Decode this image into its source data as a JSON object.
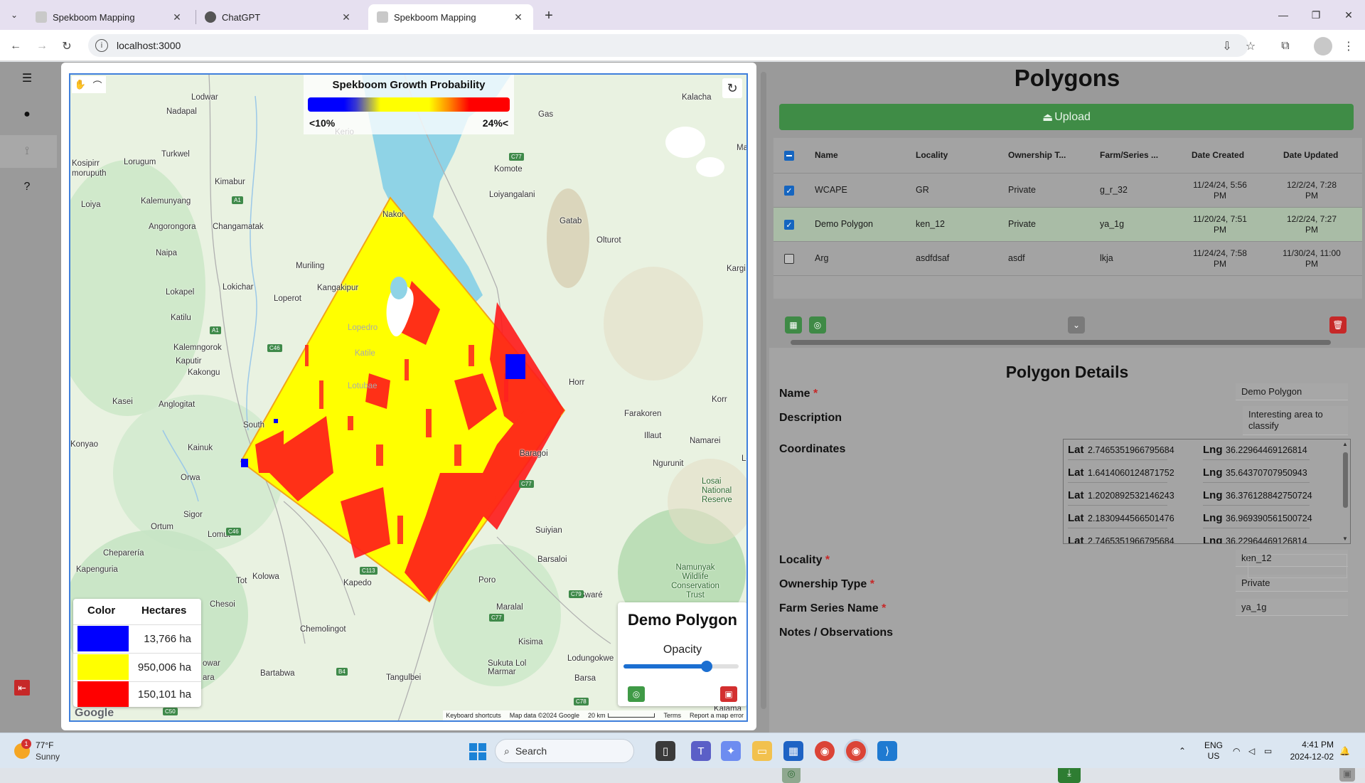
{
  "browser": {
    "tabs": [
      {
        "title": "Spekboom Mapping",
        "active": false
      },
      {
        "title": "ChatGPT",
        "active": false
      },
      {
        "title": "Spekboom Mapping",
        "active": true
      }
    ],
    "url": "localhost:3000"
  },
  "map": {
    "legend": {
      "title": "Spekboom Growth Probability",
      "low_label": "<10%",
      "high_label": "24%<"
    },
    "hectares_table": {
      "headers": [
        "Color",
        "Hectares"
      ],
      "rows": [
        {
          "color": "#0000ff",
          "hectares": "13,766 ha"
        },
        {
          "color": "#ffff00",
          "hectares": "950,006 ha"
        },
        {
          "color": "#ff0000",
          "hectares": "150,101 ha"
        }
      ]
    },
    "polygon_card": {
      "name": "Demo Polygon",
      "opacity_label": "Opacity",
      "opacity_value": 0.72
    },
    "google_logo": "Google",
    "footer": {
      "shortcuts": "Keyboard shortcuts",
      "data": "Map data ©2024 Google",
      "scale": "20 km",
      "terms": "Terms",
      "report": "Report a map error"
    },
    "places": [
      "Lodwar",
      "Nadapal",
      "Kosipirr",
      "moruputh",
      "Lorugum",
      "Turkwel",
      "Kimabur",
      "Loiya",
      "Kalemunyang",
      "Angorongora",
      "Changamatak",
      "Naipa",
      "Muriling",
      "Kangakipur",
      "Lokapel",
      "Lokichar",
      "Loperot",
      "Katilu",
      "Kalemngorok",
      "Kaputir",
      "Kakongu",
      "Kasei",
      "Anglogitat",
      "South",
      "Konyao",
      "Kainuk",
      "Orwa",
      "Sigor",
      "Ortum",
      "Lomut",
      "Cheparería",
      "Kapenguria",
      "Chesoi",
      "Tot",
      "Kolowa",
      "Kapedo",
      "Chemolingot",
      "Bartabwa",
      "Tangulbei",
      "Sukuta Lol Marmar",
      "Kisima",
      "Lodungokwe",
      "Barsa",
      "Maralal",
      "Poro",
      "Swaré",
      "Barsaloi",
      "Suiyian",
      "Baragoi",
      "Ngurunit",
      "Illaut",
      "Namarei",
      "Farakoren",
      "Korr",
      "Horr",
      "Kargi",
      "Olturot",
      "Gatab",
      "Loiyangalani",
      "Komote",
      "Kalacha",
      "Gas",
      "Ma",
      "Nakor",
      "Kerio",
      "Lopedro",
      "Katile",
      "Lotubae",
      "owar",
      "ara",
      "Namunyak Wildlife Conservation Trust",
      "Losai National Reserve",
      "Le",
      "Kalama"
    ],
    "roads": [
      "C77",
      "A1",
      "A1",
      "C46",
      "C46",
      "C77",
      "C113",
      "C79",
      "C77",
      "B4",
      "C78",
      "C50"
    ]
  },
  "polygons": {
    "title": "Polygons",
    "upload_label": "Upload",
    "columns": [
      "Name",
      "Locality",
      "Ownership T...",
      "Farm/Series ...",
      "Date Created",
      "Date Updated"
    ],
    "rows": [
      {
        "checked": true,
        "selected": false,
        "name": "WCAPE",
        "locality": "GR",
        "ownership": "Private",
        "farm": "g_r_32",
        "created": "11/24/24, 5:56 PM",
        "updated": "12/2/24, 7:28 PM"
      },
      {
        "checked": true,
        "selected": true,
        "name": "Demo Polygon",
        "locality": "ken_12",
        "ownership": "Private",
        "farm": "ya_1g",
        "created": "11/20/24, 7:51 PM",
        "updated": "12/2/24, 7:27 PM"
      },
      {
        "checked": false,
        "selected": false,
        "name": "Arg",
        "locality": "asdfdsaf",
        "ownership": "asdf",
        "farm": "lkja",
        "created": "11/24/24, 7:58 PM",
        "updated": "11/30/24, 11:00 PM"
      }
    ]
  },
  "details": {
    "title": "Polygon Details",
    "name_label": "Name",
    "name_value": "Demo Polygon",
    "description_label": "Description",
    "description_value": "Interesting area to classify",
    "coordinates_label": "Coordinates",
    "lat_label": "Lat",
    "lng_label": "Lng",
    "coordinates": [
      {
        "lat": "2.74653519667956​84",
        "lng": "36.22964469126814"
      },
      {
        "lat": "1.6414060124871752",
        "lng": "35.64370707950943"
      },
      {
        "lat": "1.2020892532146243",
        "lng": "36.376128842750724"
      },
      {
        "lat": "2.1830944566501476",
        "lng": "36.969390561500724"
      },
      {
        "lat": "2.7465351966795684",
        "lng": "36.22964469126814"
      }
    ],
    "locality_label": "Locality",
    "locality_value": "ken_12",
    "ownership_label": "Ownership Type",
    "ownership_value": "Private",
    "farm_label": "Farm Series Name",
    "farm_value": "ya_1g",
    "notes_label": "Notes / Observations",
    "notes_value": ""
  },
  "taskbar": {
    "weather_temp": "77°F",
    "weather_desc": "Sunny",
    "weather_badge": "1",
    "search_placeholder": "Search",
    "lang_top": "ENG",
    "lang_bottom": "US",
    "time": "4:41 PM",
    "date": "2024-12-02"
  },
  "colors": {
    "accent_green": "#3f8c46",
    "danger_red": "#c62828",
    "focus_blue": "#3f7fdc"
  }
}
